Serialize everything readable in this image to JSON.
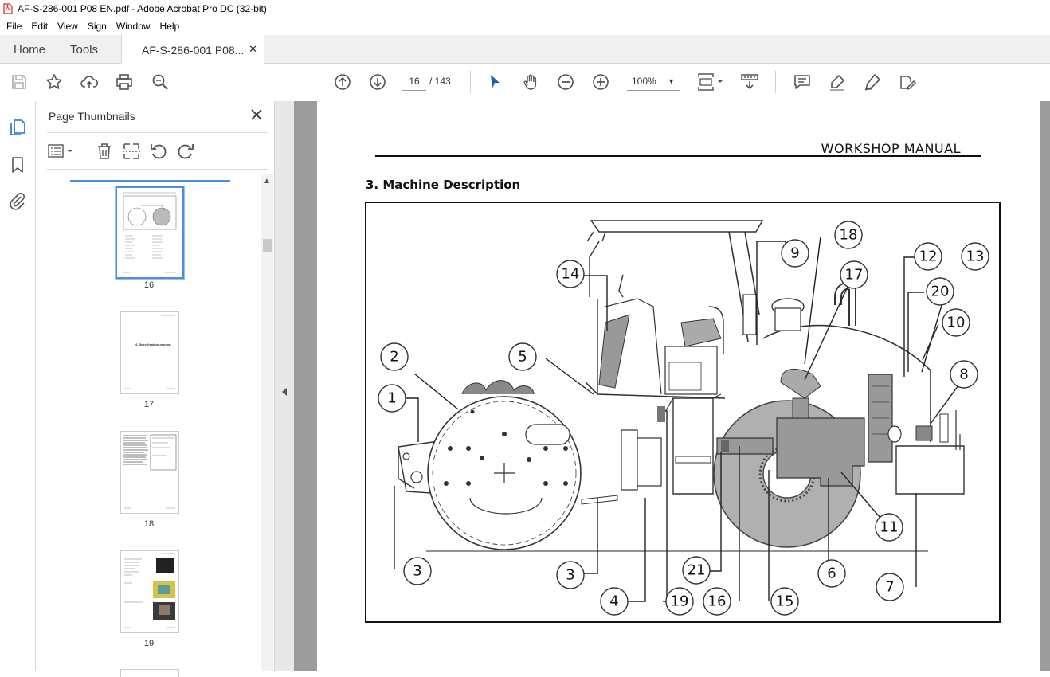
{
  "window": {
    "title": "AF-S-286-001 P08 EN.pdf - Adobe Acrobat Pro DC (32-bit)"
  },
  "menu": [
    "File",
    "Edit",
    "View",
    "Sign",
    "Window",
    "Help"
  ],
  "tabs": {
    "home": "Home",
    "tools": "Tools",
    "document": "AF-S-286-001 P08..."
  },
  "toolbar": {
    "current_page": "16",
    "total_pages": "/ 143",
    "zoom": "100%"
  },
  "thumbnails": {
    "panel_title": "Page Thumbnails",
    "pages": [
      {
        "label": "16",
        "selected": true
      },
      {
        "label": "17",
        "selected": false
      },
      {
        "label": "18",
        "selected": false
      },
      {
        "label": "19",
        "selected": false
      }
    ],
    "page17_text": "4.  Specification manual"
  },
  "document": {
    "header": "WORKSHOP MANUAL",
    "section_title": "3. Machine Description",
    "callouts": [
      "1",
      "2",
      "3",
      "3",
      "4",
      "5",
      "6",
      "7",
      "8",
      "9",
      "10",
      "11",
      "12",
      "13",
      "14",
      "15",
      "16",
      "17",
      "18",
      "19",
      "20",
      "21"
    ]
  },
  "colors": {
    "accent": "#4a8fe2",
    "drum": "#b0b0b0",
    "panel_bg": "#9c9c9c"
  }
}
